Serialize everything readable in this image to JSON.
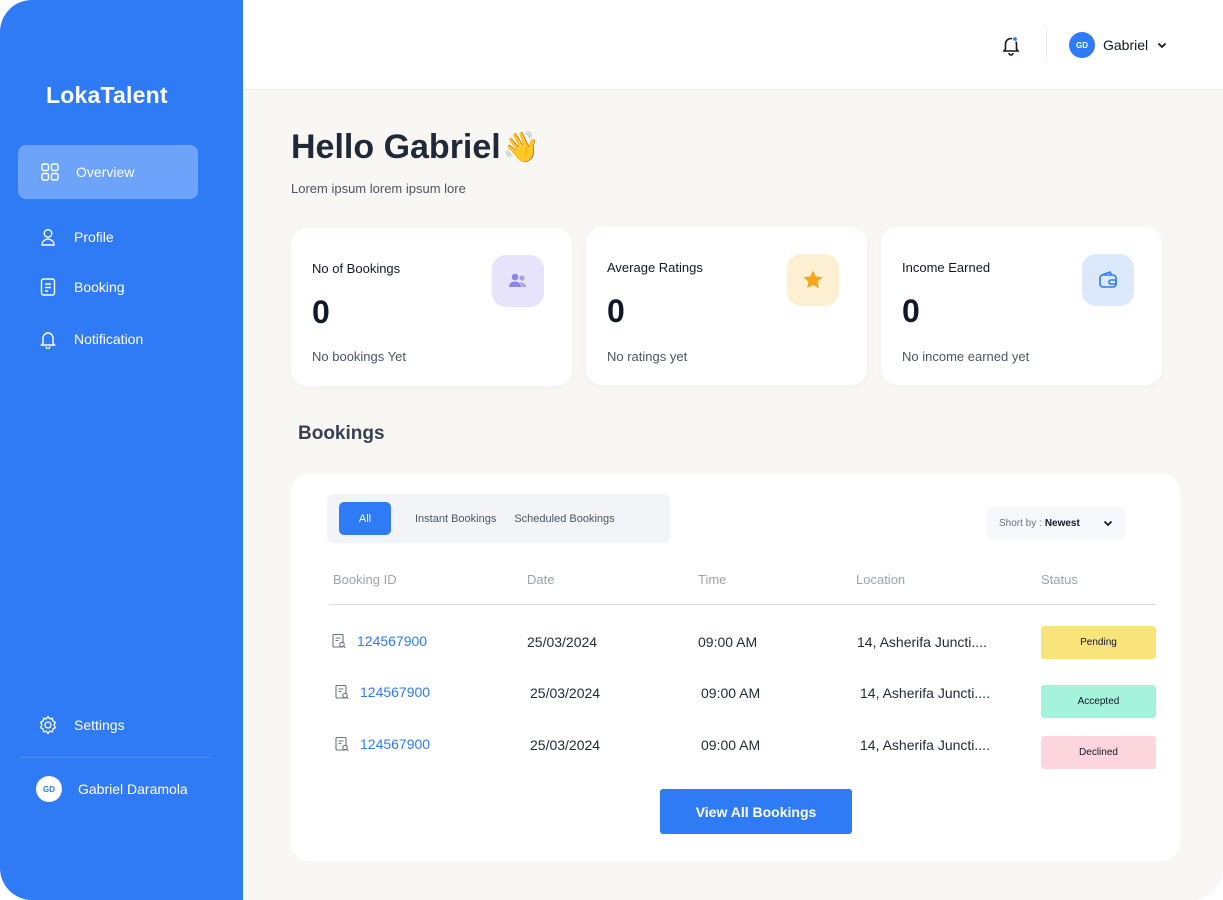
{
  "app": {
    "brand": "LokaTalent"
  },
  "sidebar": {
    "items": [
      {
        "label": "Overview",
        "icon": "grid-icon",
        "active": true
      },
      {
        "label": "Profile",
        "icon": "user-icon"
      },
      {
        "label": "Booking",
        "icon": "booking-doc-icon"
      },
      {
        "label": "Notification",
        "icon": "bell-icon"
      }
    ],
    "settings_label": "Settings",
    "user": {
      "initials": "GD",
      "name": "Gabriel Daramola"
    }
  },
  "topbar": {
    "user_initials": "GD",
    "user_name": "Gabriel"
  },
  "main": {
    "greeting": "Hello Gabriel",
    "greeting_emoji": "👋",
    "subtext": "Lorem ipsum lorem ipsum lore",
    "cards": [
      {
        "label": "No of Bookings",
        "value": "0",
        "note": "No bookings Yet",
        "icon": "people-icon",
        "badge_color": "#e6e3fb",
        "icon_color": "#8c84e6"
      },
      {
        "label": "Average Ratings",
        "value": "0",
        "note": "No ratings yet",
        "icon": "star-icon",
        "badge_color": "#fdf0d2",
        "icon_color": "#f5a623"
      },
      {
        "label": "Income Earned",
        "value": "0",
        "note": "No income earned yet",
        "icon": "wallet-icon",
        "badge_color": "#dce8fb",
        "icon_color": "#2f7bf5"
      }
    ],
    "bookings_title": "Bookings"
  },
  "bookings": {
    "tabs": [
      "All",
      "Instant Bookings",
      "Scheduled Bookings"
    ],
    "sort_prefix": "Short by :",
    "sort_value": "Newest",
    "columns": [
      "Booking ID",
      "Date",
      "Time",
      "Location",
      "Status"
    ],
    "rows": [
      {
        "id": "124567900",
        "date": "25/03/2024",
        "time": "09:00 AM",
        "location": "14, Asherifa Juncti....",
        "status": "Pending",
        "status_color": "#f8e47a"
      },
      {
        "id": "124567900",
        "date": "25/03/2024",
        "time": "09:00 AM",
        "location": "14, Asherifa Juncti....",
        "status": "Accepted",
        "status_color": "#a6f3dc"
      },
      {
        "id": "124567900",
        "date": "25/03/2024",
        "time": "09:00 AM",
        "location": "14, Asherifa Juncti....",
        "status": "Declined",
        "status_color": "#fdd5dc"
      }
    ],
    "view_all_label": "View All Bookings"
  },
  "colors": {
    "primary": "#2f7bf5",
    "background": "#f8f7f4"
  }
}
